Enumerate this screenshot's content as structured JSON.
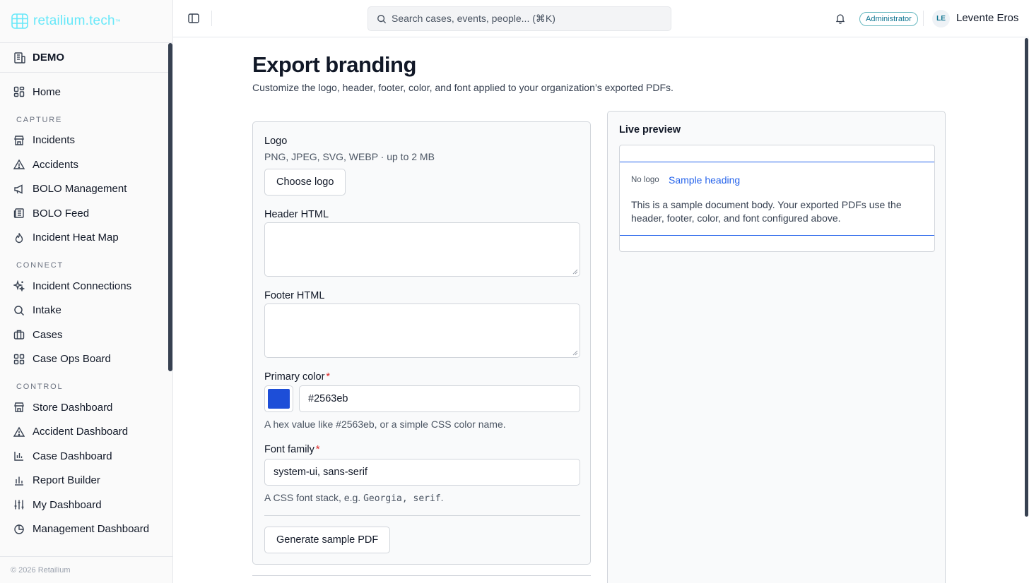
{
  "brand": {
    "name": "retailium.tech",
    "tm": "™"
  },
  "org": {
    "name": "DEMO"
  },
  "nav": {
    "home": "Home",
    "capture_label": "CAPTURE",
    "capture": [
      "Incidents",
      "Accidents",
      "BOLO Management",
      "BOLO Feed",
      "Incident Heat Map"
    ],
    "connect_label": "CONNECT",
    "connect": [
      "Incident Connections",
      "Intake",
      "Cases",
      "Case Ops Board"
    ],
    "control_label": "CONTROL",
    "control": [
      "Store Dashboard",
      "Accident Dashboard",
      "Case Dashboard",
      "Report Builder",
      "My Dashboard",
      "Management Dashboard"
    ]
  },
  "footer": {
    "copyright": "© 2026 Retailium"
  },
  "topbar": {
    "search_placeholder": "Search cases, events, people... (⌘K)",
    "role": "Administrator",
    "user_initials": "LE",
    "user_name": "Levente Eros"
  },
  "page": {
    "title": "Export branding",
    "subtitle": "Customize the logo, header, footer, color, and font applied to your organization’s exported PDFs."
  },
  "form": {
    "logo_label": "Logo",
    "logo_hint": "PNG, JPEG, SVG, WEBP · up to 2 MB",
    "choose_logo": "Choose logo",
    "header_label": "Header HTML",
    "header_value": "",
    "footer_label": "Footer HTML",
    "footer_value": "",
    "color_label": "Primary color",
    "required_mark": "*",
    "color_value": "#2563eb",
    "color_hint": "A hex value like #2563eb, or a simple CSS color name.",
    "font_label": "Font family",
    "font_value": "system-ui, sans-serif",
    "font_hint_prefix": "A CSS font stack, e.g.",
    "font_hint_code": "Georgia, serif",
    "font_hint_suffix": ".",
    "generate_button": "Generate sample PDF"
  },
  "preview": {
    "title": "Live preview",
    "no_logo": "No logo",
    "heading": "Sample heading",
    "body": "This is a sample document body. Your exported PDFs use the header, footer, color, and font configured above."
  },
  "colors": {
    "accent": "#2563eb",
    "brand": "#67e8f9",
    "required": "#dc2626"
  }
}
